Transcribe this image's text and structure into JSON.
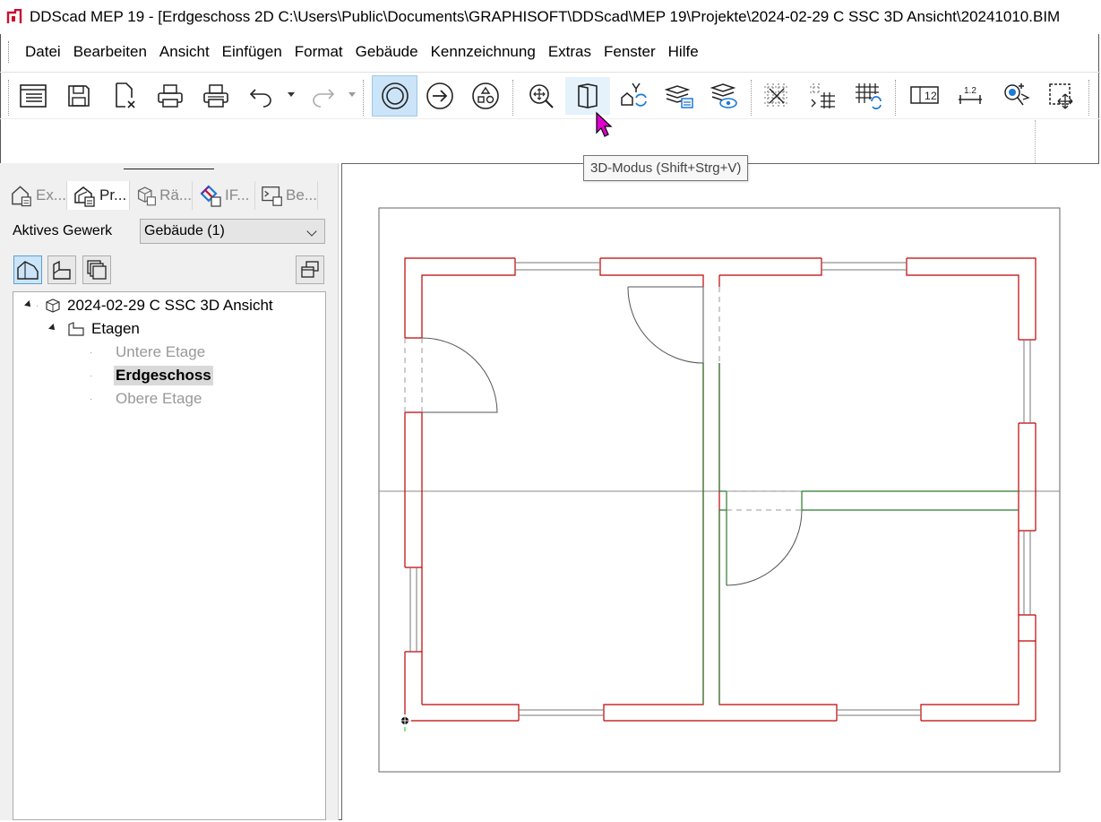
{
  "window": {
    "title": "DDScad MEP 19 - [Erdgeschoss  2D  C:\\Users\\Public\\Documents\\GRAPHISOFT\\DDScad\\MEP 19\\Projekte\\2024-02-29 C SSC 3D Ansicht\\20241010.BIM"
  },
  "menu": [
    "Datei",
    "Bearbeiten",
    "Ansicht",
    "Einfügen",
    "Format",
    "Gebäude",
    "Kennzeichnung",
    "Extras",
    "Fenster",
    "Hilfe"
  ],
  "toolbar": {
    "buttons": [
      {
        "name": "properties",
        "icon": "properties-icon"
      },
      {
        "name": "save",
        "icon": "save-icon"
      },
      {
        "name": "close-file",
        "icon": "close-file-icon"
      },
      {
        "name": "print",
        "icon": "print-icon"
      },
      {
        "name": "print-preview",
        "icon": "print-preview-icon"
      },
      {
        "name": "undo",
        "icon": "undo-icon"
      },
      {
        "name": "redo",
        "icon": "redo-icon"
      },
      {
        "name": "select-mode",
        "icon": "circle-mode-icon",
        "active": true
      },
      {
        "name": "arrow-mode",
        "icon": "arrow-circle-icon"
      },
      {
        "name": "symbols-mode",
        "icon": "shapes-icon"
      },
      {
        "name": "zoom",
        "icon": "zoom-icon"
      },
      {
        "name": "3d-mode",
        "icon": "3d-cube-icon",
        "hover": true
      },
      {
        "name": "floor-switch",
        "icon": "floor-switch-icon"
      },
      {
        "name": "layers",
        "icon": "layers-icon"
      },
      {
        "name": "layers-visibility",
        "icon": "layers-eye-icon"
      },
      {
        "name": "snap-grid",
        "icon": "snap-grid-icon"
      },
      {
        "name": "snap-grid-move",
        "icon": "grid-move-icon"
      },
      {
        "name": "grid-refresh",
        "icon": "grid-refresh-icon"
      },
      {
        "name": "dimension-12",
        "icon": "dimension-icon"
      },
      {
        "name": "measure",
        "icon": "measure-icon"
      },
      {
        "name": "point-select",
        "icon": "point-select-icon"
      },
      {
        "name": "window-select",
        "icon": "window-select-icon"
      }
    ],
    "tooltip": "3D-Modus (Shift+Strg+V)"
  },
  "panel": {
    "tabs": [
      {
        "label": "Ex...",
        "icon": "house-list-icon"
      },
      {
        "label": "Pr...",
        "icon": "house-props-icon",
        "active": true
      },
      {
        "label": "Rä...",
        "icon": "room-icon"
      },
      {
        "label": "IF...",
        "icon": "ifc-icon"
      },
      {
        "label": "Be...",
        "icon": "command-icon"
      }
    ],
    "gewerk_label": "Aktives Gewerk",
    "gewerk_value": "Gebäude (1)",
    "tree": {
      "project": "2024-02-29 C SSC 3D Ansicht",
      "group": "Etagen",
      "floors": [
        "Untere Etage",
        "Erdgeschoss",
        "Obere Etage"
      ],
      "active_floor": "Erdgeschoss"
    }
  },
  "colors": {
    "accent": "#cce4f7",
    "wall_outer": "#c00000",
    "wall_inner": "#2a7a2a",
    "cursor": "#e000d0"
  }
}
